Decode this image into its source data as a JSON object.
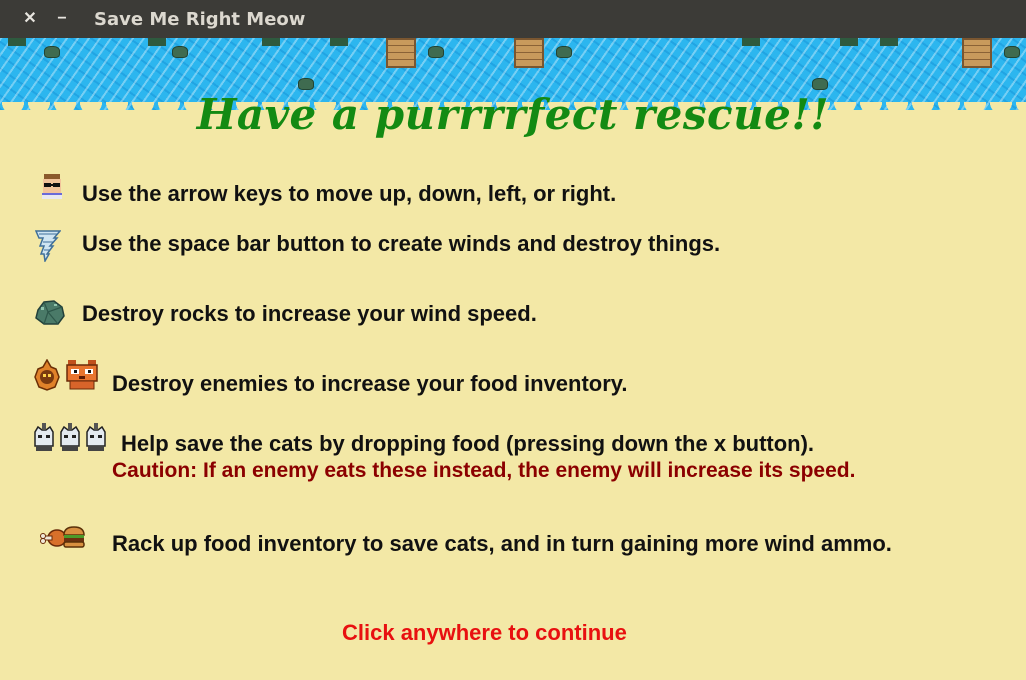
{
  "window": {
    "title": "Save Me Right Meow",
    "close_glyph": "✕",
    "minimize_glyph": "−"
  },
  "headline": "Have a purrrrfect rescue!!",
  "instructions": [
    {
      "icon": "player-icon",
      "text": "Use the arrow keys to move up, down, left, or right."
    },
    {
      "icon": "tornado-icon",
      "text": "Use the space bar button to create winds and destroy things."
    },
    {
      "icon": "rock-icon",
      "text": "Destroy rocks to increase your wind speed."
    },
    {
      "icon": "enemy-icons",
      "text": "Destroy enemies to increase your food inventory."
    },
    {
      "icon": "cat-icons",
      "text": "Help save the cats by dropping food (pressing down the x button).",
      "caution": "Caution: If an enemy eats these instead, the enemy will increase its speed."
    },
    {
      "icon": "food-icons",
      "text": "Rack up food inventory to save cats, and in turn gaining more wind ammo."
    }
  ],
  "continue_prompt": "Click anywhere to continue",
  "colors": {
    "sand": "#f3e8a6",
    "water": "#2cb6ef",
    "headline": "#138a13",
    "caution": "#8b0000",
    "continue": "#e81010"
  }
}
